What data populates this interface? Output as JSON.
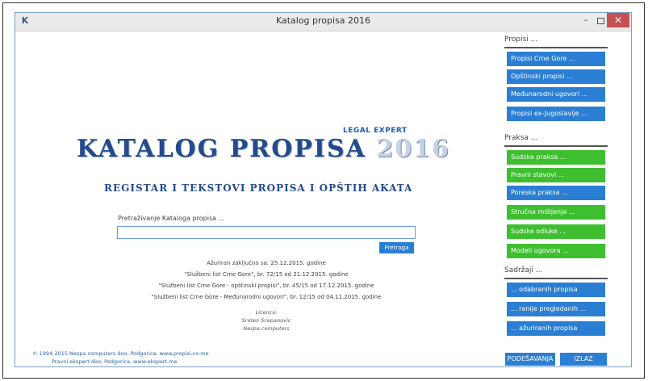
{
  "window": {
    "title": "Katalog propisa 2016",
    "icon": "K",
    "minimize": "–",
    "close": "✕"
  },
  "logo": {
    "legal_expert": "LEGAL EXPERT",
    "main": "KATALOG PROPISA",
    "year": "2016",
    "subtitle": "REGISTAR I TEKSTOVI PROPISA I OPŠTIH AKATA"
  },
  "search": {
    "label": "Pretraživanje Kataloga propisa ...",
    "value": "",
    "button": "Pretraga"
  },
  "info": [
    "Ažuriran zaključno sa: 25.12.2015. godine",
    "\"Službeni list Crne Gore\", br. 72/15 od 21.12.2015. godine",
    "\"Službeni list Crne Gore - opštinski propisi\", br. 45/15 od 17.12.2015. godine",
    "\"Službeni list Crne Gore - Međunarodni ugovori\", br. 12/15 od 04.11.2015. godine"
  ],
  "licence": [
    "Licenca:",
    "Sreten Scepanovic",
    "Nespa computers"
  ],
  "footer": [
    "© 1994-2015 Nespa computers doo, Podgorica, www.propisi.co.me",
    "Pravni ekspert doo, Podgorica, www.ekspert.me"
  ],
  "sidebar": {
    "propisi": {
      "title": "Propisi ...",
      "items": [
        "Propisi Crne Gore ...",
        "Opštinski propisi ...",
        "Međunarodni ugovori ...",
        "Propisi ex-Jugoslavije ..."
      ]
    },
    "praksa": {
      "title": "Praksa ...",
      "items": [
        "Sudska praksa ...",
        "Pravni stavovi ...",
        "Poreska praksa ...",
        "Stručna mišljenja ...",
        "Sudske odluke ...",
        "Modeli ugovora ..."
      ]
    },
    "sadrzaji": {
      "title": "Sadržaji ...",
      "items": [
        "... odabranih propisa",
        "... ranije pregledanih ...",
        "... ažuriranih propisa"
      ]
    }
  },
  "buttons": {
    "settings": "PODEŠAVANJA",
    "exit": "IZLAZ"
  },
  "colors": {
    "blue": "#2a7fd4",
    "green": "#3fbf30",
    "logo": "#244a8a"
  }
}
